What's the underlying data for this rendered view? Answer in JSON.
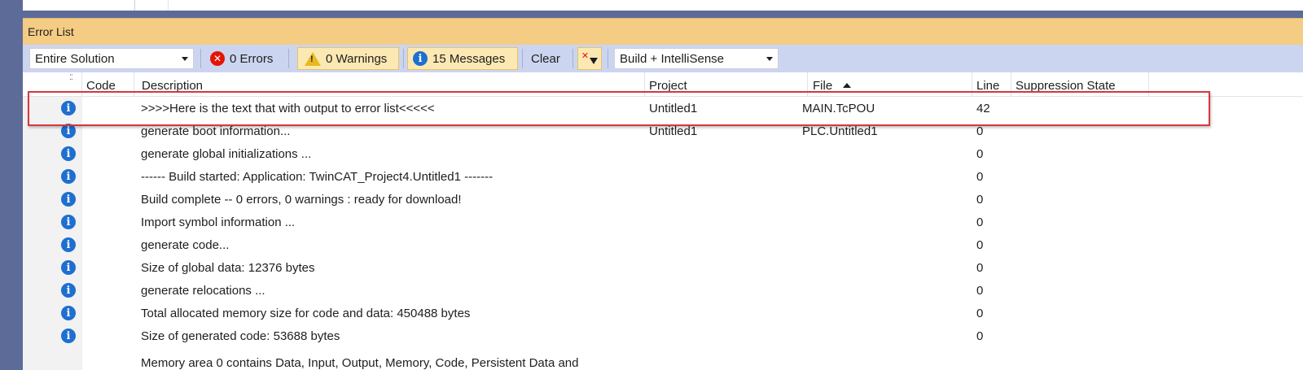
{
  "panel": {
    "title": "Error List"
  },
  "toolbar": {
    "scope": "Entire Solution",
    "errors": "0 Errors",
    "warnings": "0 Warnings",
    "messages": "15 Messages",
    "clear": "Clear",
    "source": "Build + IntelliSense"
  },
  "columns": {
    "code": "Code",
    "description": "Description",
    "project": "Project",
    "file": "File",
    "line": "Line",
    "suppression": "Suppression State"
  },
  "rows": [
    {
      "description": ">>>>Here is the text that with output to error list<<<<<",
      "project": "Untitled1",
      "file": "MAIN.TcPOU",
      "line": "42"
    },
    {
      "description": "generate boot information...",
      "project": "Untitled1",
      "file": "PLC.Untitled1",
      "line": "0"
    },
    {
      "description": "generate global initializations ...",
      "project": "",
      "file": "",
      "line": "0"
    },
    {
      "description": "------ Build started: Application: TwinCAT_Project4.Untitled1 -------",
      "project": "",
      "file": "",
      "line": "0"
    },
    {
      "description": "Build complete -- 0 errors, 0 warnings : ready for download!",
      "project": "",
      "file": "",
      "line": "0"
    },
    {
      "description": "Import symbol information ...",
      "project": "",
      "file": "",
      "line": "0"
    },
    {
      "description": "generate code...",
      "project": "",
      "file": "",
      "line": "0"
    },
    {
      "description": "Size of global data: 12376 bytes",
      "project": "",
      "file": "",
      "line": "0"
    },
    {
      "description": "generate relocations ...",
      "project": "",
      "file": "",
      "line": "0"
    },
    {
      "description": "Total allocated memory size for code and data: 450488 bytes",
      "project": "",
      "file": "",
      "line": "0"
    },
    {
      "description": "Size of generated code: 53688 bytes",
      "project": "",
      "file": "",
      "line": "0"
    }
  ],
  "cutoff_row": "Memory area 0 contains  Data, Input, Output, Memory, Code, Persistent Data and",
  "colors": {
    "title_bg": "#f5cc84",
    "toolbar_bg": "#ccd5f0",
    "info_blue": "#1e6fd0",
    "error_red": "#e51400",
    "warning_yellow": "#e8b923",
    "highlight_red": "#d9363e"
  },
  "icons": {
    "error": "error-circle-icon",
    "warning": "warning-triangle-icon",
    "info": "info-circle-icon",
    "filter": "clear-filter-icon"
  }
}
